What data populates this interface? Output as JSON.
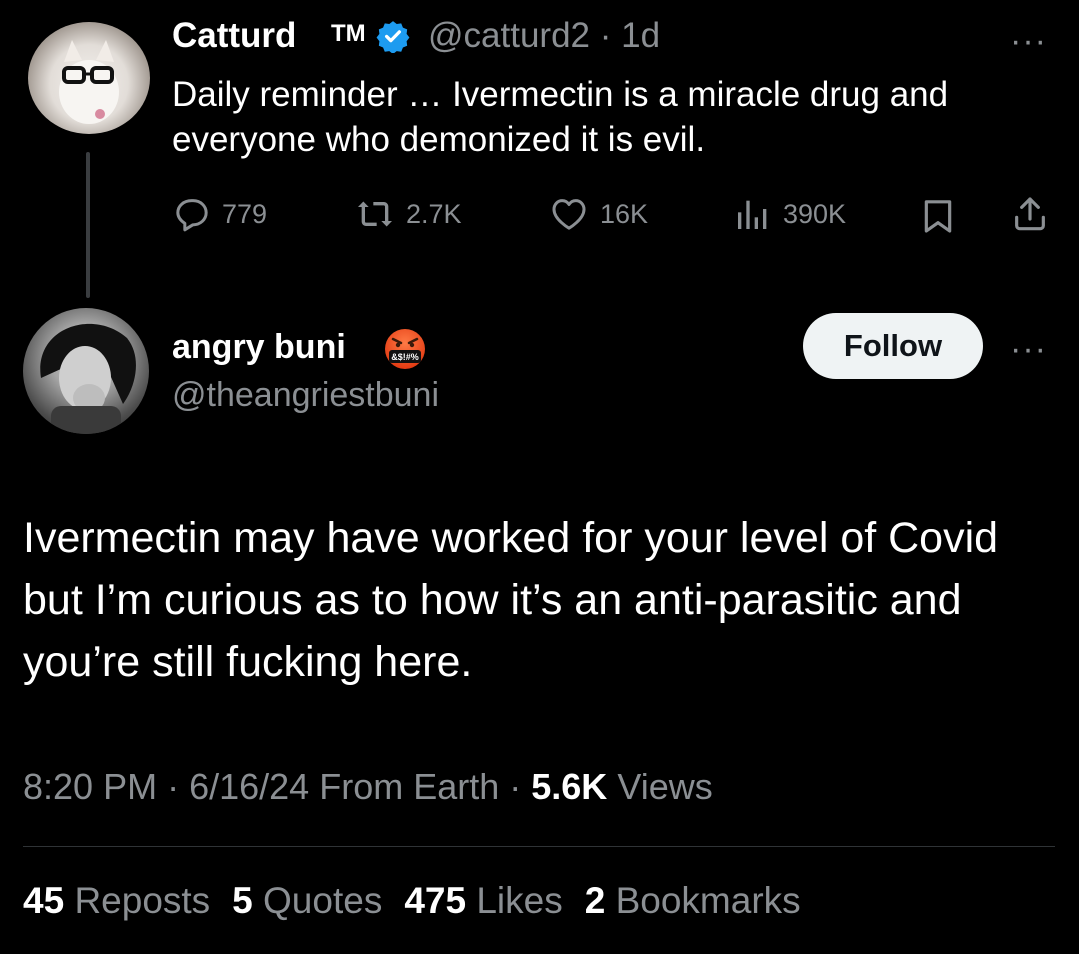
{
  "tweet1": {
    "name": "Catturd",
    "trademark": "TM",
    "handle": "@catturd2",
    "time": "1d",
    "text": "Daily reminder … Ivermectin is a miracle drug and everyone who demonized it is evil.",
    "replies": "779",
    "reposts": "2.7K",
    "likes": "16K",
    "views": "390K",
    "more": "···"
  },
  "tweet2": {
    "name": "angry buni",
    "emoji": "&$!#%",
    "handle": "@theangriestbuni",
    "follow_label": "Follow",
    "more": "···",
    "text": "Ivermectin may have worked for your level of Covid but I’m curious as to how it’s an anti-parasitic and you’re still fucking here.",
    "time": "8:20 PM",
    "date": "6/16/24",
    "source": "From Earth",
    "views_count": "5.6K",
    "views_label": "Views",
    "stats": {
      "reposts_count": "45",
      "reposts_label": "Reposts",
      "quotes_count": "5",
      "quotes_label": "Quotes",
      "likes_count": "475",
      "likes_label": "Likes",
      "bookmarks_count": "2",
      "bookmarks_label": "Bookmarks"
    }
  },
  "colors": {
    "background": "#000000",
    "text": "#e7e9ea",
    "muted": "#8b8f93",
    "verified": "#1d9bf0"
  },
  "icons": [
    "verified-icon",
    "reply-icon",
    "repost-icon",
    "like-icon",
    "views-icon",
    "bookmark-icon",
    "share-icon",
    "angry-emoji-icon"
  ]
}
